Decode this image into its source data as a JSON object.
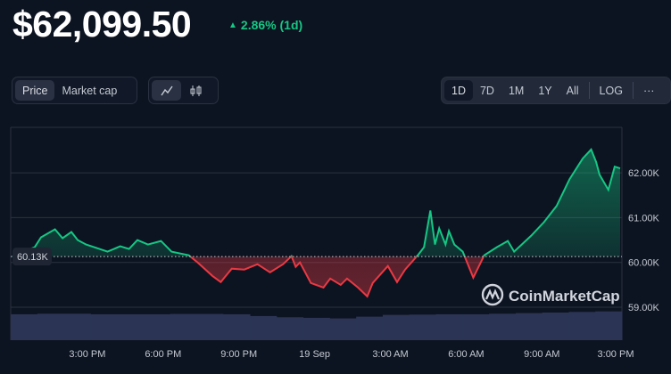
{
  "header": {
    "price": "$62,099.50",
    "change": "2.86% (1d)",
    "change_direction": "up",
    "change_color": "#16c784"
  },
  "toolbar": {
    "metric_tabs": [
      {
        "label": "Price",
        "active": true
      },
      {
        "label": "Market cap",
        "active": false
      }
    ],
    "chart_type_buttons": [
      {
        "icon": "line-chart-icon",
        "active": true
      },
      {
        "icon": "candlestick-icon",
        "active": false
      }
    ],
    "timeframes": [
      {
        "label": "1D",
        "active": true
      },
      {
        "label": "7D"
      },
      {
        "label": "1M"
      },
      {
        "label": "1Y"
      },
      {
        "label": "All"
      }
    ],
    "log_label": "LOG",
    "more_label": "···"
  },
  "chart_data": {
    "type": "area",
    "baseline": 60130,
    "baseline_label": "60.13K",
    "up_color": "#16c784",
    "down_color": "#ea3943",
    "y_ticks": [
      {
        "value": 62000,
        "label": "62.00K"
      },
      {
        "value": 61000,
        "label": "61.00K"
      },
      {
        "value": 60000,
        "label": "60.00K"
      },
      {
        "value": 59000,
        "label": "59.00K"
      }
    ],
    "x_tick_labels": [
      "3:00 PM",
      "6:00 PM",
      "9:00 PM",
      "19 Sep",
      "3:00 AM",
      "6:00 AM",
      "9:00 AM",
      "3:00 PM"
    ],
    "grid": true,
    "watermark": "CoinMarketCap",
    "series": [
      [
        "18 12:02",
        60130
      ],
      [
        "18 12:55",
        60340
      ],
      [
        "18 13:10",
        60560
      ],
      [
        "18 13:43",
        60740
      ],
      [
        "18 14:01",
        60540
      ],
      [
        "18 14:22",
        60680
      ],
      [
        "18 14:37",
        60500
      ],
      [
        "18 14:57",
        60400
      ],
      [
        "18 15:48",
        60240
      ],
      [
        "18 16:18",
        60360
      ],
      [
        "18 16:39",
        60300
      ],
      [
        "18 16:59",
        60500
      ],
      [
        "18 17:24",
        60400
      ],
      [
        "18 17:55",
        60480
      ],
      [
        "18 18:20",
        60240
      ],
      [
        "18 19:01",
        60160
      ],
      [
        "18 19:22",
        60000
      ],
      [
        "18 19:57",
        59700
      ],
      [
        "18 20:17",
        59560
      ],
      [
        "18 20:43",
        59860
      ],
      [
        "18 21:13",
        59840
      ],
      [
        "18 21:44",
        59960
      ],
      [
        "18 22:14",
        59780
      ],
      [
        "18 22:45",
        59960
      ],
      [
        "18 23:05",
        60140
      ],
      [
        "18 23:15",
        59900
      ],
      [
        "18 23:25",
        60000
      ],
      [
        "18 23:51",
        59540
      ],
      [
        "19 00:21",
        59440
      ],
      [
        "19 00:37",
        59640
      ],
      [
        "19 01:02",
        59500
      ],
      [
        "19 01:17",
        59640
      ],
      [
        "19 01:43",
        59440
      ],
      [
        "19 02:05",
        59240
      ],
      [
        "19 02:18",
        59540
      ],
      [
        "19 02:54",
        59920
      ],
      [
        "19 03:16",
        59560
      ],
      [
        "19 03:35",
        59840
      ],
      [
        "19 04:05",
        60160
      ],
      [
        "19 04:20",
        60340
      ],
      [
        "19 04:35",
        61160
      ],
      [
        "19 04:46",
        60400
      ],
      [
        "19 04:56",
        60760
      ],
      [
        "19 05:11",
        60400
      ],
      [
        "19 05:19",
        60700
      ],
      [
        "19 05:32",
        60400
      ],
      [
        "19 05:52",
        60240
      ],
      [
        "19 06:17",
        59660
      ],
      [
        "19 06:43",
        60160
      ],
      [
        "19 07:13",
        60340
      ],
      [
        "19 07:39",
        60480
      ],
      [
        "19 07:54",
        60240
      ],
      [
        "19 08:35",
        60600
      ],
      [
        "19 09:05",
        60900
      ],
      [
        "19 09:35",
        61260
      ],
      [
        "19 10:06",
        61860
      ],
      [
        "19 10:37",
        62320
      ],
      [
        "19 10:57",
        62520
      ],
      [
        "19 11:09",
        62240
      ],
      [
        "19 11:17",
        61960
      ],
      [
        "19 11:38",
        61620
      ],
      [
        "19 11:53",
        62140
      ],
      [
        "19 12:06",
        62100
      ]
    ],
    "volume_relative": [
      0.88,
      0.9,
      0.9,
      0.88,
      0.88,
      0.88,
      0.89,
      0.89,
      0.88,
      0.82,
      0.78,
      0.76,
      0.74,
      0.8,
      0.86,
      0.87,
      0.88,
      0.88,
      0.9,
      0.92,
      0.94,
      0.96,
      0.98
    ]
  }
}
